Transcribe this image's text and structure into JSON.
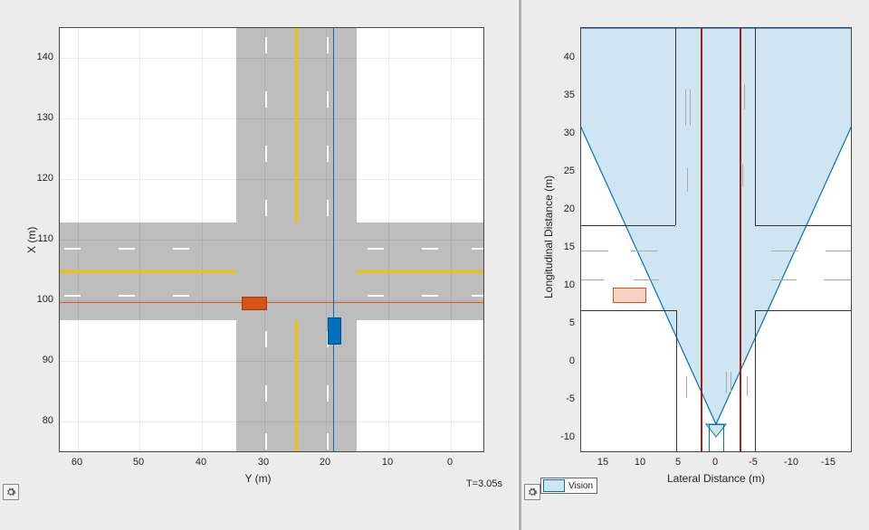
{
  "timestamp": "T=3.05s",
  "left_plot": {
    "x_axis_label": "Y (m)",
    "y_axis_label": "X (m)",
    "x_ticks": [
      60,
      50,
      40,
      30,
      20,
      10,
      0
    ],
    "y_ticks": [
      80,
      90,
      100,
      110,
      120,
      130,
      140
    ]
  },
  "right_plot": {
    "x_axis_label": "Lateral Distance (m)",
    "y_axis_label": "Longitudinal Distance (m)",
    "x_ticks": [
      15,
      10,
      5,
      0,
      -5,
      -10,
      -15
    ],
    "y_ticks": [
      -10,
      -5,
      0,
      5,
      10,
      15,
      20,
      25,
      30,
      35,
      40
    ],
    "legend_label": "Vision"
  },
  "chart_data": [
    {
      "type": "scatter",
      "title": "Bird's-eye scenario view",
      "xlabel": "Y (m)",
      "ylabel": "X (m)",
      "xlim": [
        63,
        -5
      ],
      "ylim": [
        75,
        145
      ],
      "x_reversed": true,
      "road": {
        "intersection_center": {
          "x": 100,
          "y": 25
        },
        "horizontal_span_x": [
          97,
          113
        ],
        "vertical_span_y": [
          15,
          35
        ]
      },
      "vehicles": [
        {
          "name": "ego",
          "color": "#d95319",
          "x": 99.5,
          "y": 32,
          "heading_deg": 0
        },
        {
          "name": "target",
          "color": "#0072bd",
          "x": 95,
          "y": 19,
          "heading_deg": 90
        }
      ],
      "lane_center_lines": [
        {
          "axis": "horizontal",
          "x": 100,
          "color": "#d95319"
        },
        {
          "axis": "vertical",
          "y": 19,
          "color": "#0072bd"
        }
      ]
    },
    {
      "type": "scatter",
      "title": "Ego-centric vision sensor view",
      "xlabel": "Lateral Distance (m)",
      "ylabel": "Longitudinal Distance (m)",
      "xlim": [
        18,
        -18
      ],
      "ylim": [
        -12,
        44
      ],
      "x_reversed": true,
      "sensor": {
        "name": "Vision",
        "fov_half_angle_deg": 35,
        "range_m": 44,
        "origin": {
          "lat": 0,
          "lon": 3
        }
      },
      "ego_outline": {
        "lat": [
          -1,
          1
        ],
        "lon": [
          -1,
          3.5
        ]
      },
      "detections": [
        {
          "name": "target",
          "lat": 12,
          "lon": 5.5,
          "width": 4.5,
          "height": 2
        }
      ],
      "lane_boundaries": [
        {
          "lat": 2,
          "color": "#a02020"
        },
        {
          "lat": -3,
          "color": "#a02020"
        }
      ]
    }
  ]
}
